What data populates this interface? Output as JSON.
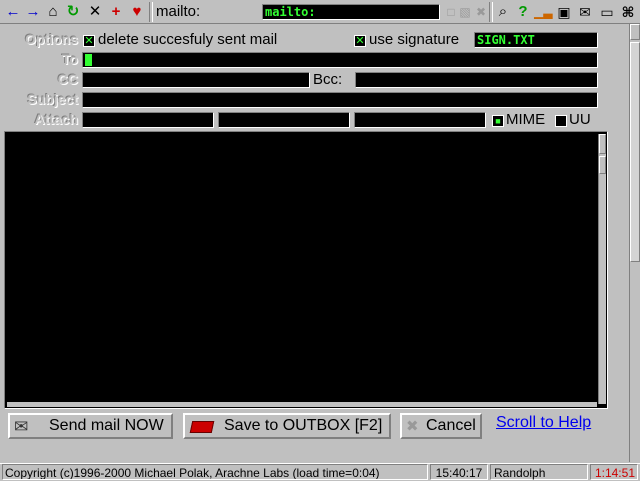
{
  "toolbar": {
    "icons": [
      "back-arrow",
      "forward-arrow",
      "home",
      "reload",
      "stop-x",
      "add-bookmark-plus",
      "hotlist-heart"
    ],
    "address_label": "mailto:",
    "address_value": "mailto:",
    "right_icons": [
      "search",
      "help",
      "chart",
      "download",
      "save-disk",
      "mail",
      "window",
      "fullscreen"
    ]
  },
  "form": {
    "options_label": "Options",
    "delete_sent_label": "delete succesfuly sent mail",
    "use_signature_label": "use signature",
    "signature_file": "SIGN.TXT",
    "to_label": "To",
    "cc_label": "CC",
    "bcc_label": "Bcc:",
    "subject_label": "Subject",
    "attach_label": "Attach",
    "mime_label": "MIME",
    "uu_label": "UU"
  },
  "buttons": {
    "send": "Send mail NOW",
    "save_outbox": "Save to OUTBOX [F2]",
    "cancel": "Cancel",
    "help_link": "Scroll to Help"
  },
  "status": {
    "copyright": "Copyright (c)1996-2000 Michael Polak, Arachne Labs (load time=0:04)",
    "time": "15:40:17",
    "user": "Randolph",
    "online_time": "1:14:51"
  },
  "colors": {
    "accent_green": "#33ff33",
    "link_blue": "#0000ee",
    "online_red": "#cc0000"
  }
}
